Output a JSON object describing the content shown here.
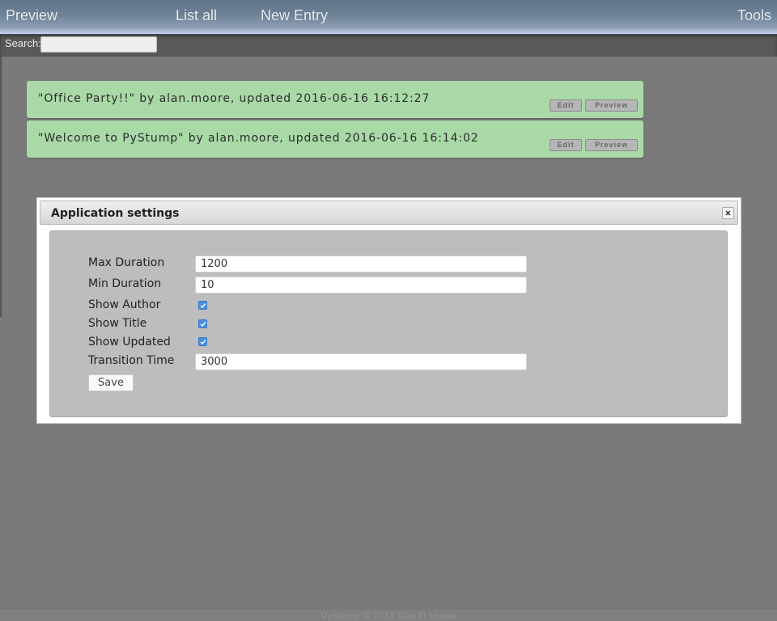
{
  "nav": {
    "preview": "Preview",
    "list_all": "List all",
    "new_entry": "New Entry",
    "tools": "Tools"
  },
  "search": {
    "label": "Search:",
    "value": "",
    "placeholder": ""
  },
  "entries": [
    {
      "text": "\"Office Party!!\" by alan.moore, updated 2016-06-16 16:12:27",
      "edit_label": "Edit",
      "preview_label": "Preview"
    },
    {
      "text": "\"Welcome to PyStump\" by alan.moore, updated 2016-06-16 16:14:02",
      "edit_label": "Edit",
      "preview_label": "Preview"
    }
  ],
  "dialog": {
    "title": "Application settings",
    "close_icon": "close-icon",
    "fields": {
      "max_duration": {
        "label": "Max Duration",
        "value": "1200"
      },
      "min_duration": {
        "label": "Min Duration",
        "value": "10"
      },
      "show_author": {
        "label": "Show Author",
        "checked": true
      },
      "show_title": {
        "label": "Show Title",
        "checked": true
      },
      "show_updated": {
        "label": "Show Updated",
        "checked": true
      },
      "transition_time": {
        "label": "Transition Time",
        "value": "3000"
      }
    },
    "save_label": "Save"
  },
  "footer": {
    "text": "PyStump © 2014 Alan D.Moore"
  },
  "colors": {
    "entry_bg": "#a9d9a7",
    "page_bg": "#7a7a7a",
    "checkbox": "#4a8fe0"
  }
}
